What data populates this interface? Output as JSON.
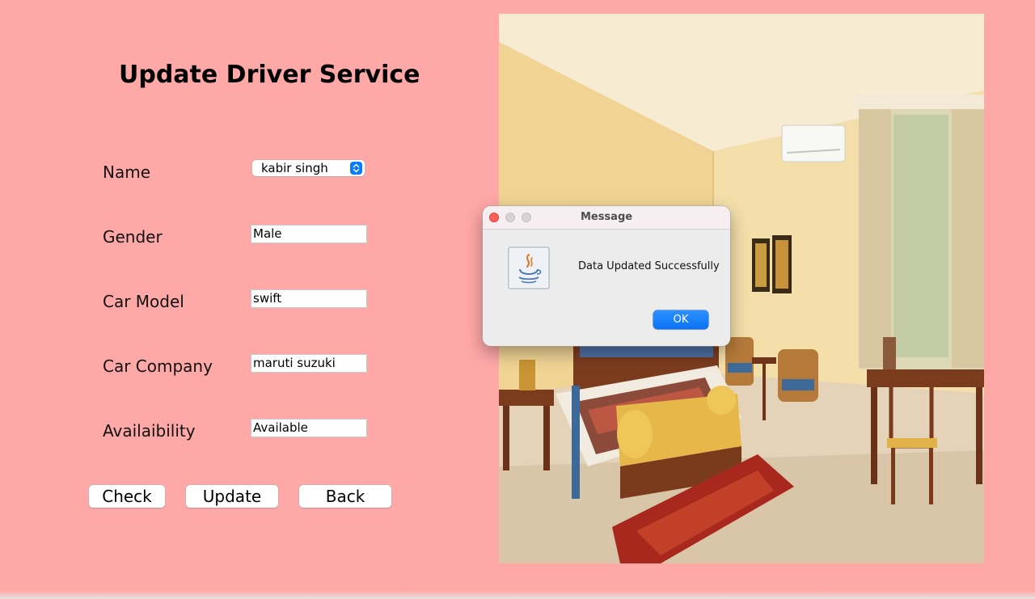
{
  "form": {
    "title": "Update Driver Service",
    "fields": [
      {
        "label": "Name",
        "value": "kabir singh"
      },
      {
        "label": "Gender",
        "value": "Male"
      },
      {
        "label": "Car Model",
        "value": "swift"
      },
      {
        "label": "Car Company",
        "value": "maruti suzuki"
      },
      {
        "label": "Availaibility",
        "value": "Available"
      }
    ],
    "buttons": {
      "check": "Check",
      "update": "Update",
      "back": "Back"
    }
  },
  "image": {
    "description": "hotel-room"
  },
  "dialog": {
    "title": "Message",
    "message": "Data Updated Successfully",
    "ok_label": "OK",
    "icon": "java-icon"
  },
  "colors": {
    "background": "#ffa8a8",
    "accent": "#0a7bff",
    "close_button": "#fe5f57"
  }
}
